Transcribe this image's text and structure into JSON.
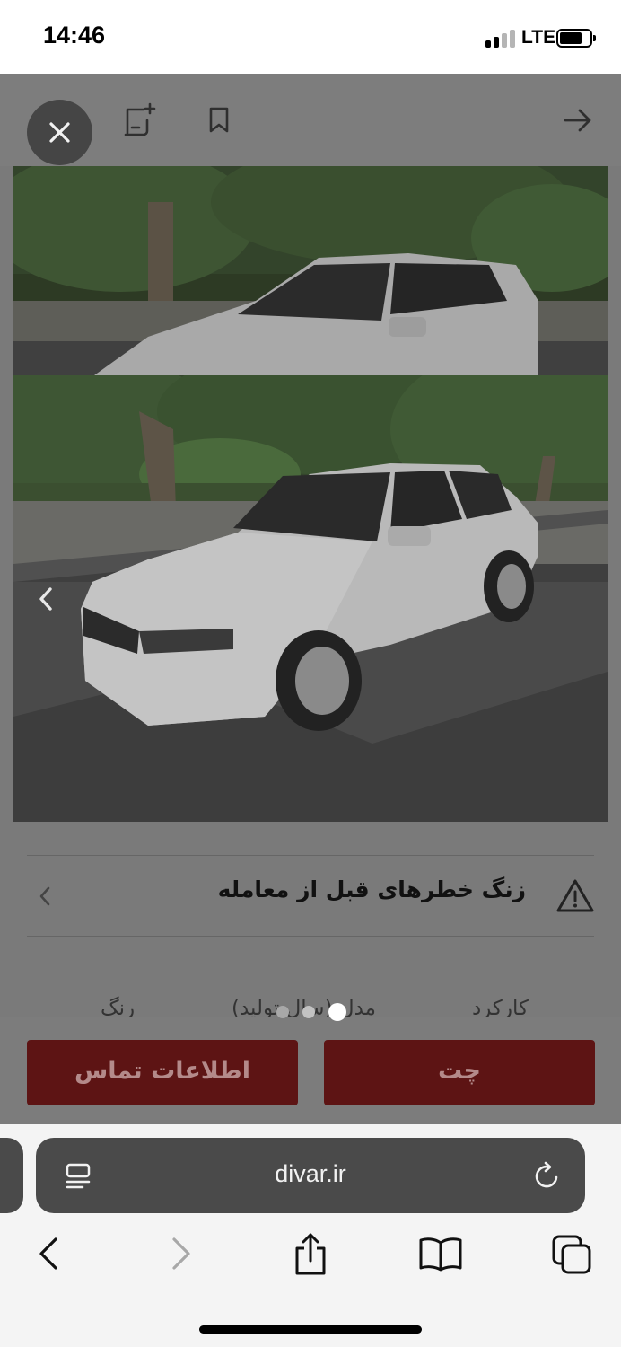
{
  "status_bar": {
    "time": "14:46",
    "network": "LTE"
  },
  "ad": {
    "warning_text": "زنگ خطرهای قبل از معامله",
    "specs": [
      "کارکرد",
      "مدل (سال تولید)",
      "رنگ"
    ],
    "contact_button": "اطلاعات تماس",
    "chat_button": "چت",
    "image_count": 3,
    "active_image": 1
  },
  "browser": {
    "url": "divar.ir"
  },
  "colors": {
    "button": "#5d1414",
    "overlay": "#7a7a7a",
    "url_bar": "#4a4a4a"
  }
}
